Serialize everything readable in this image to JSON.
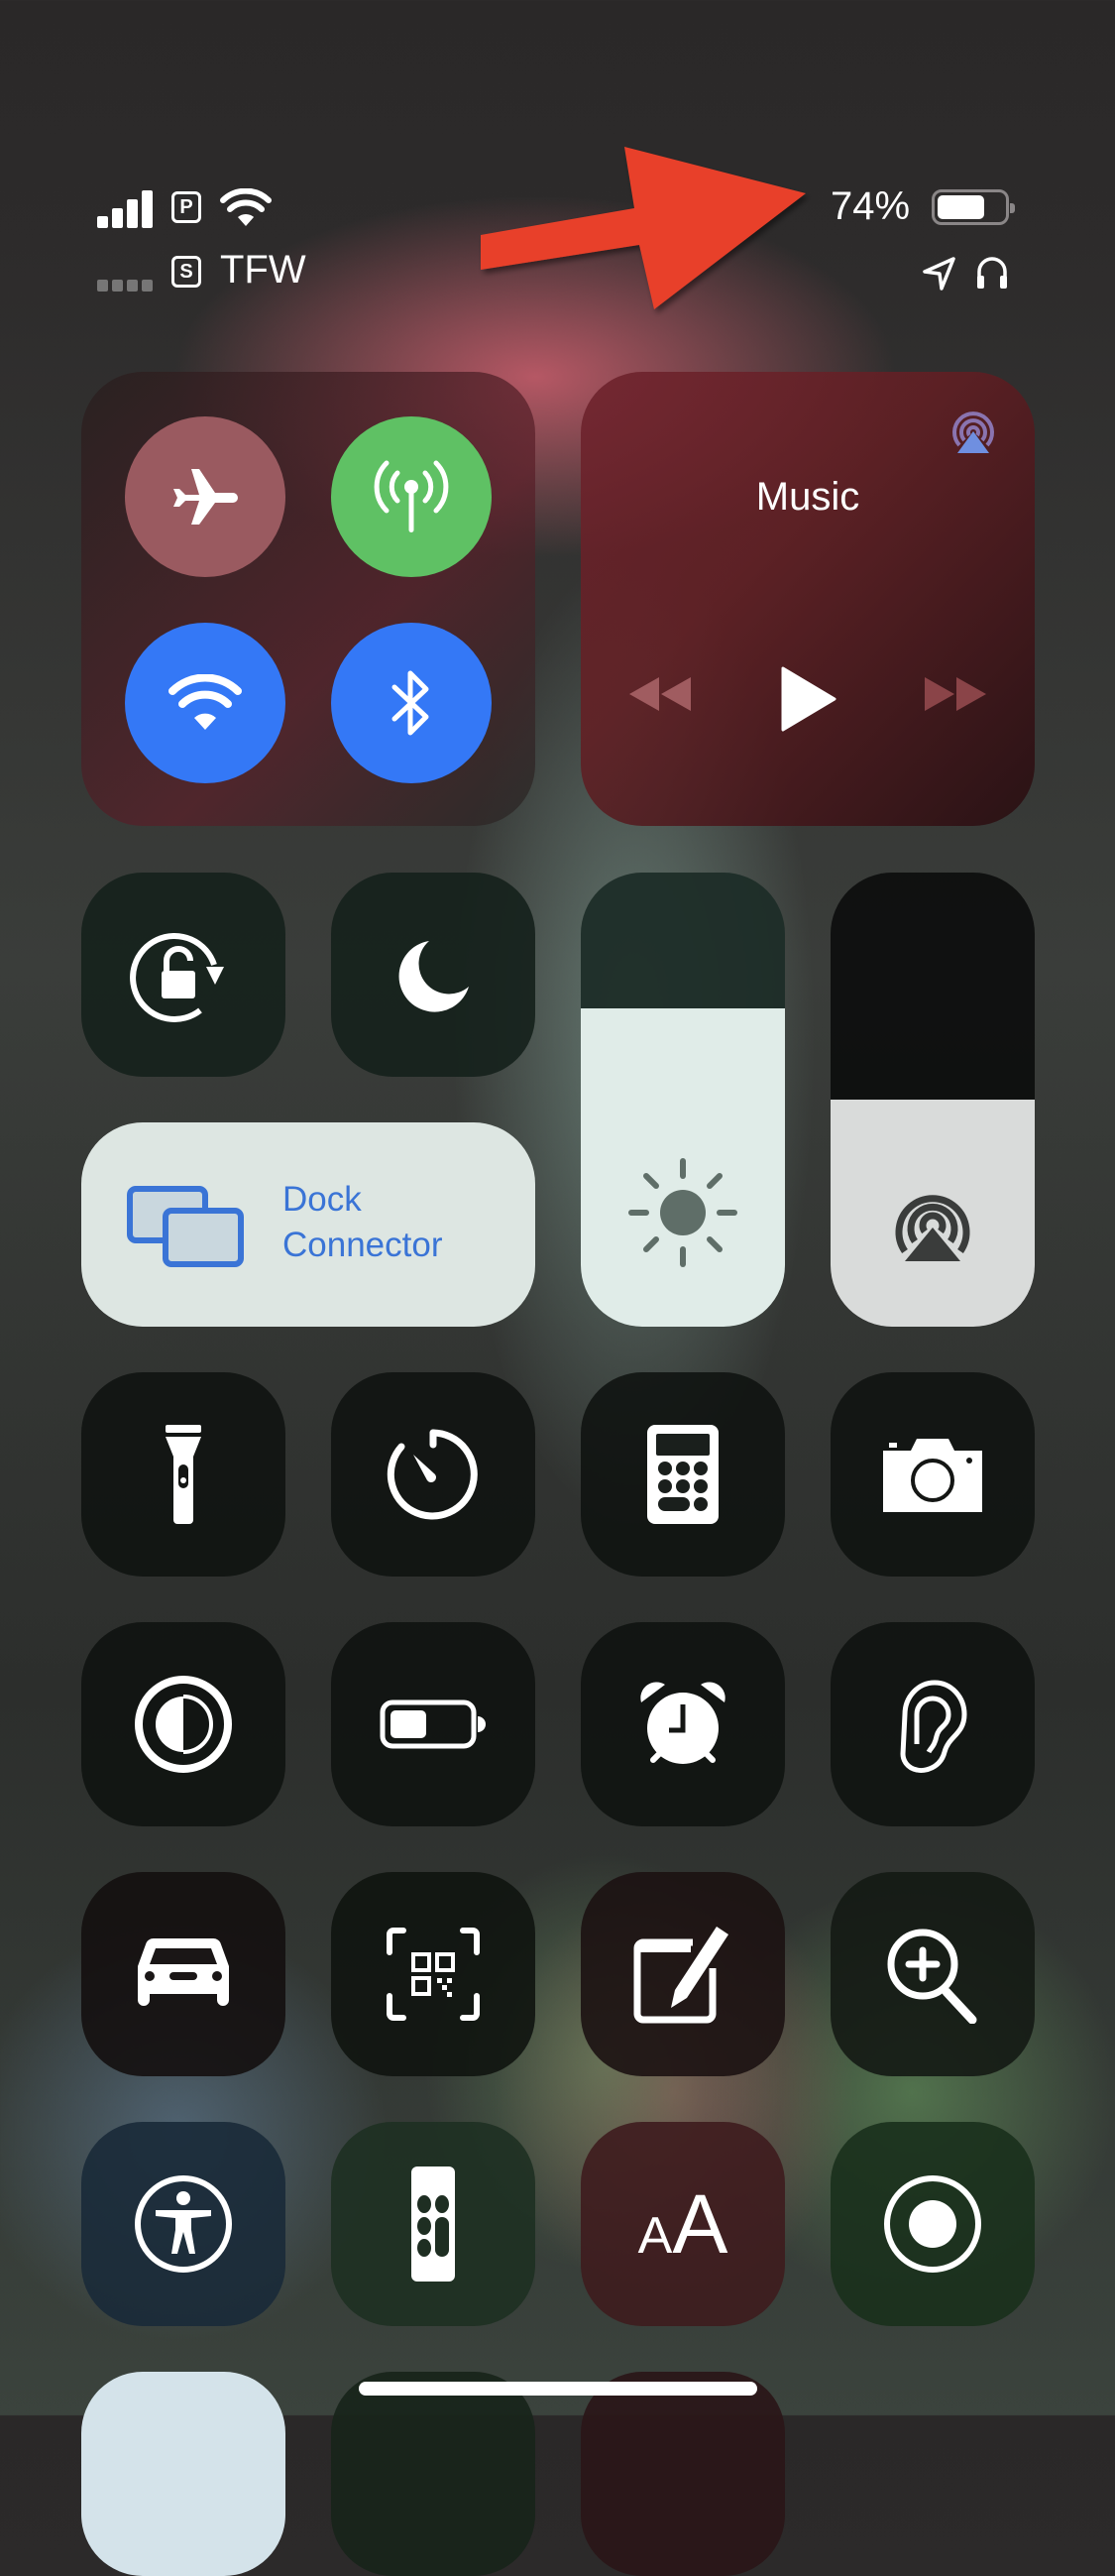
{
  "status_bar": {
    "primary_line_badge": "P",
    "secondary_line_badge": "S",
    "secondary_carrier": "TFW",
    "battery_percent_text": "74%",
    "battery_level": 0.74,
    "icons": [
      "cellular-signal-icon",
      "wifi-icon",
      "location-arrow-icon",
      "headphones-icon"
    ]
  },
  "annotation": {
    "type": "arrow",
    "color": "#e8412a",
    "points_to": "battery-percentage"
  },
  "connectivity": {
    "airplane_mode": {
      "label": "Airplane Mode",
      "on": false,
      "color": "#9a5a60"
    },
    "cellular_data": {
      "label": "Cellular Data",
      "on": true,
      "color": "#5fc164"
    },
    "wifi": {
      "label": "Wi-Fi",
      "on": true,
      "color": "#3478f6"
    },
    "bluetooth": {
      "label": "Bluetooth",
      "on": true,
      "color": "#3478f6"
    }
  },
  "now_playing": {
    "title": "Music",
    "airplay_color": "#6f8fe0",
    "controls": [
      "rewind",
      "play",
      "fast-forward"
    ]
  },
  "screen_mirroring": {
    "line1": "Dock",
    "line2": "Connector",
    "color": "#3a74d6"
  },
  "brightness": {
    "label": "Brightness",
    "level": 0.7
  },
  "volume": {
    "label": "Volume",
    "level": 0.5
  },
  "controls": [
    {
      "name": "orientation-lock",
      "label": "Orientation Lock"
    },
    {
      "name": "do-not-disturb",
      "label": "Do Not Disturb"
    },
    {
      "name": "flashlight",
      "label": "Flashlight"
    },
    {
      "name": "timer",
      "label": "Timer"
    },
    {
      "name": "calculator",
      "label": "Calculator"
    },
    {
      "name": "camera",
      "label": "Camera"
    },
    {
      "name": "dark-mode",
      "label": "Dark Mode"
    },
    {
      "name": "low-power-mode",
      "label": "Low Power Mode"
    },
    {
      "name": "alarm",
      "label": "Alarm"
    },
    {
      "name": "hearing",
      "label": "Hearing"
    },
    {
      "name": "driving-focus",
      "label": "Do Not Disturb While Driving"
    },
    {
      "name": "code-scanner",
      "label": "Scan QR Code"
    },
    {
      "name": "notes",
      "label": "Notes"
    },
    {
      "name": "magnifier",
      "label": "Magnifier"
    },
    {
      "name": "accessibility-shortcuts",
      "label": "Accessibility Shortcuts"
    },
    {
      "name": "apple-tv-remote",
      "label": "Apple TV Remote"
    },
    {
      "name": "text-size",
      "label": "Text Size",
      "glyph_small": "A",
      "glyph_large": "A"
    },
    {
      "name": "screen-recording",
      "label": "Screen Recording"
    }
  ]
}
